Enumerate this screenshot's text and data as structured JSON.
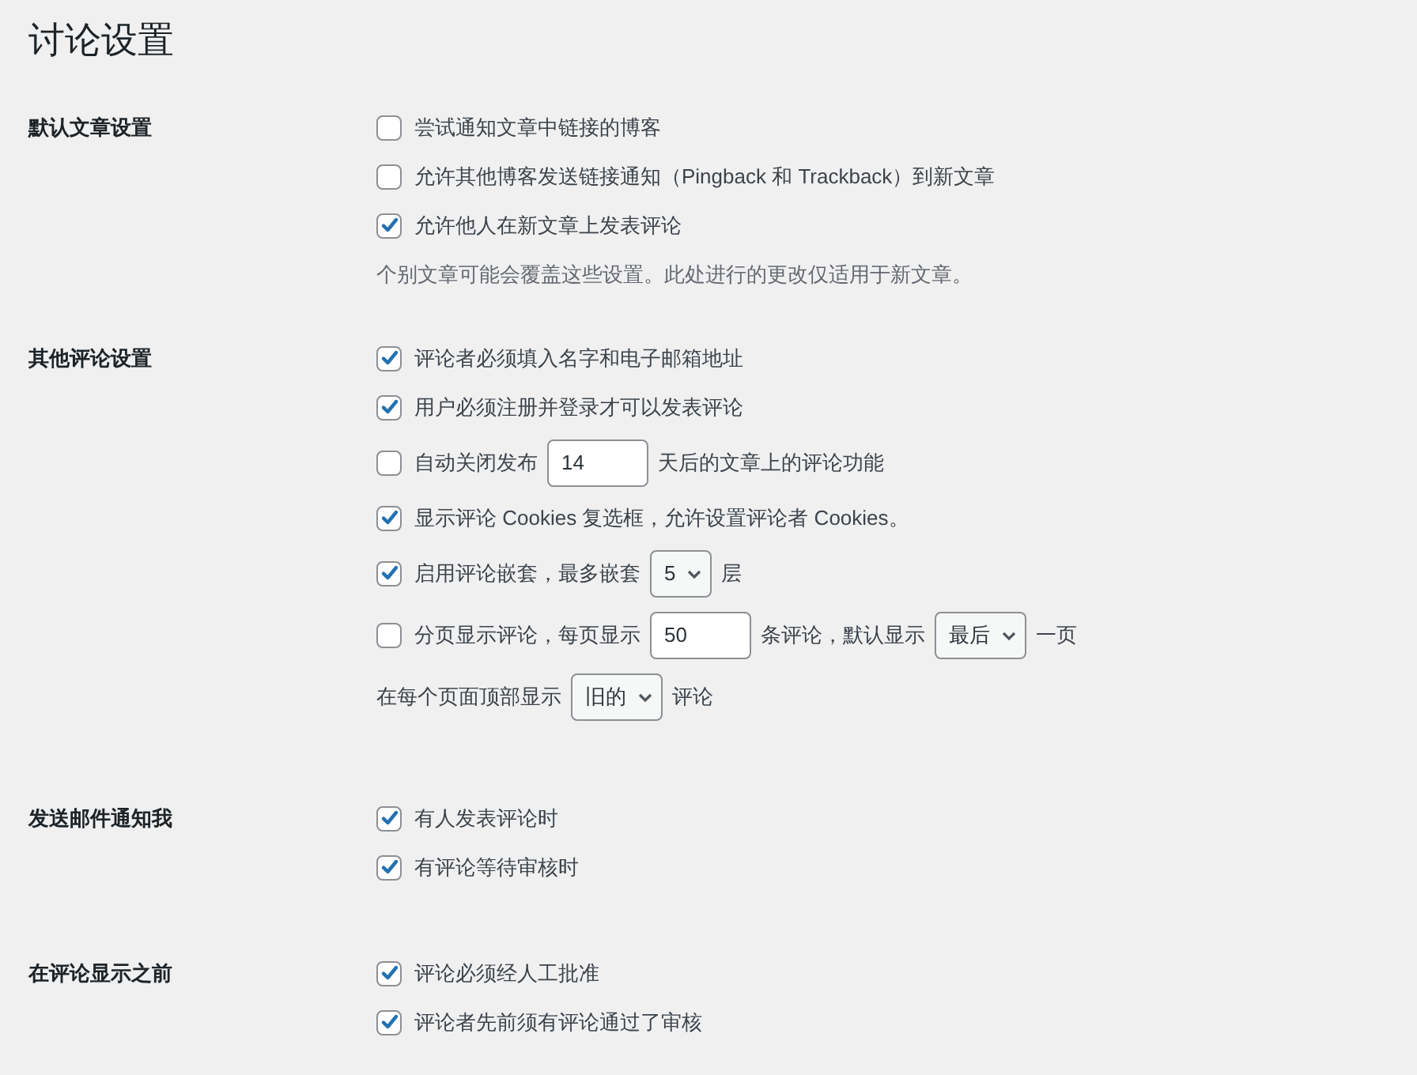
{
  "title": "讨论设置",
  "sections": [
    {
      "label": "默认文章设置",
      "rows": [
        {
          "kind": "checkbox",
          "checked": false,
          "parts": [
            {
              "kind": "text",
              "text": "尝试通知文章中链接的博客"
            }
          ]
        },
        {
          "kind": "checkbox",
          "checked": false,
          "parts": [
            {
              "kind": "text",
              "text": "允许其他博客发送链接通知（Pingback 和 Trackback）到新文章"
            }
          ]
        },
        {
          "kind": "checkbox",
          "checked": true,
          "parts": [
            {
              "kind": "text",
              "text": "允许他人在新文章上发表评论"
            }
          ]
        },
        {
          "kind": "note",
          "parts": [
            {
              "kind": "text",
              "text": "个别文章可能会覆盖这些设置。此处进行的更改仅适用于新文章。"
            }
          ]
        }
      ]
    },
    {
      "label": "其他评论设置",
      "rows": [
        {
          "kind": "checkbox",
          "checked": true,
          "parts": [
            {
              "kind": "text",
              "text": "评论者必须填入名字和电子邮箱地址"
            }
          ]
        },
        {
          "kind": "checkbox",
          "checked": true,
          "parts": [
            {
              "kind": "text",
              "text": "用户必须注册并登录才可以发表评论"
            }
          ]
        },
        {
          "kind": "checkbox",
          "checked": false,
          "parts": [
            {
              "kind": "text",
              "text": "自动关闭发布"
            },
            {
              "kind": "input",
              "value": "14"
            },
            {
              "kind": "text",
              "text": "天后的文章上的评论功能"
            }
          ]
        },
        {
          "kind": "checkbox",
          "checked": true,
          "parts": [
            {
              "kind": "text",
              "text": "显示评论 Cookies 复选框，允许设置评论者 Cookies。"
            }
          ]
        },
        {
          "kind": "checkbox",
          "checked": true,
          "parts": [
            {
              "kind": "text",
              "text": "启用评论嵌套，最多嵌套"
            },
            {
              "kind": "select",
              "value": "5"
            },
            {
              "kind": "text",
              "text": "层"
            }
          ]
        },
        {
          "kind": "checkbox",
          "checked": false,
          "parts": [
            {
              "kind": "text",
              "text": "分页显示评论，每页显示"
            },
            {
              "kind": "input",
              "value": "50"
            },
            {
              "kind": "text",
              "text": "条评论，默认显示"
            },
            {
              "kind": "select",
              "value": "最后"
            },
            {
              "kind": "text",
              "text": "一页"
            }
          ]
        },
        {
          "kind": "line",
          "parts": [
            {
              "kind": "text",
              "text": "在每个页面顶部显示"
            },
            {
              "kind": "select",
              "value": "旧的"
            },
            {
              "kind": "text",
              "text": "评论"
            }
          ]
        }
      ]
    },
    {
      "label": "发送邮件通知我",
      "rows": [
        {
          "kind": "checkbox",
          "checked": true,
          "parts": [
            {
              "kind": "text",
              "text": "有人发表评论时"
            }
          ]
        },
        {
          "kind": "checkbox",
          "checked": true,
          "parts": [
            {
              "kind": "text",
              "text": "有评论等待审核时"
            }
          ]
        }
      ]
    },
    {
      "label": "在评论显示之前",
      "rows": [
        {
          "kind": "checkbox",
          "checked": true,
          "parts": [
            {
              "kind": "text",
              "text": "评论必须经人工批准"
            }
          ]
        },
        {
          "kind": "checkbox",
          "checked": true,
          "parts": [
            {
              "kind": "text",
              "text": "评论者先前须有评论通过了审核"
            }
          ]
        }
      ]
    }
  ]
}
